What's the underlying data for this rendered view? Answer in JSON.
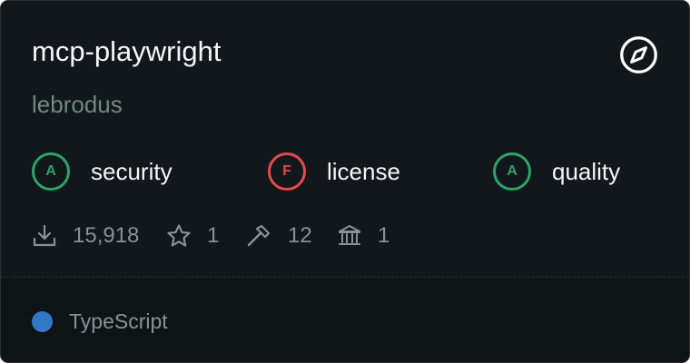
{
  "package": {
    "name": "mcp-playwright",
    "author": "lebrodus"
  },
  "header": {
    "explore_icon": "compass-icon"
  },
  "grades": [
    {
      "grade": "A",
      "label": "security",
      "color": "#2fa16a"
    },
    {
      "grade": "F",
      "label": "license",
      "color": "#e5484d"
    },
    {
      "grade": "A",
      "label": "quality",
      "color": "#2fa16a"
    }
  ],
  "stats": {
    "downloads": {
      "icon": "download-icon",
      "value": "15,918"
    },
    "stars": {
      "icon": "star-icon",
      "value": "1"
    },
    "tools": {
      "icon": "hammer-icon",
      "value": "12"
    },
    "institutions": {
      "icon": "bank-icon",
      "value": "1"
    }
  },
  "language": {
    "name": "TypeScript",
    "color": "#3178c6"
  }
}
